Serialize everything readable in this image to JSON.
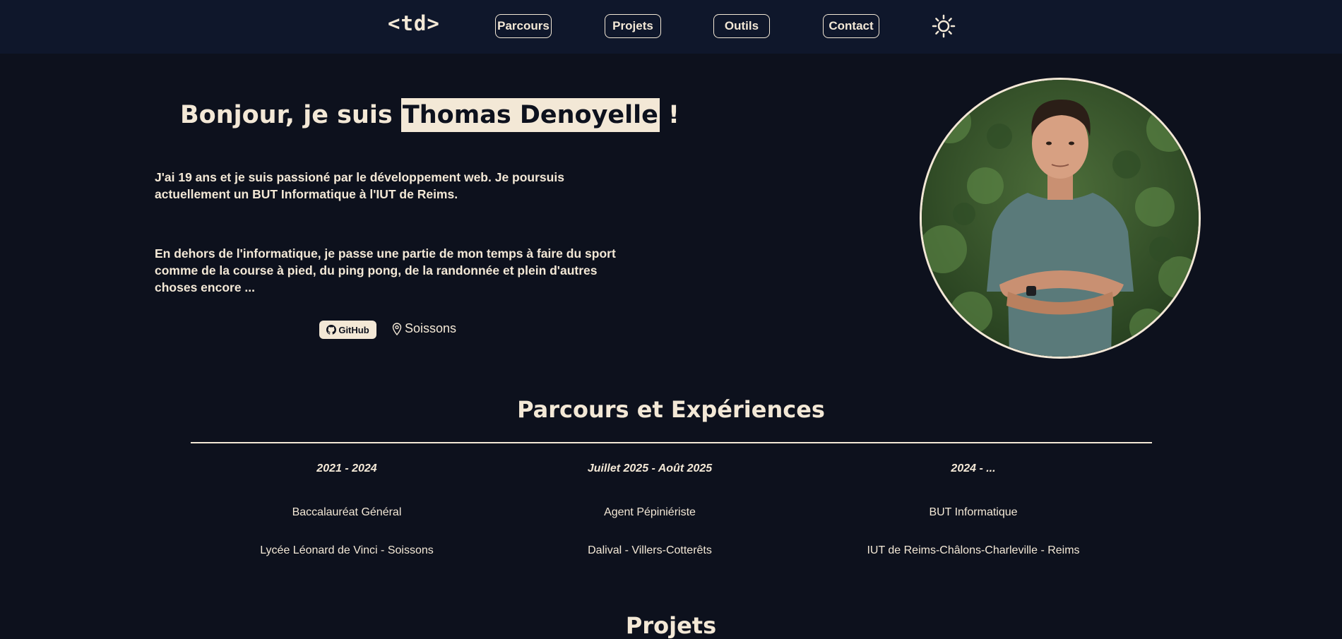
{
  "colors": {
    "background": "#0d111d",
    "nav_background": "#0f172b",
    "accent": "#f3e8d6"
  },
  "nav": {
    "logo": "<td>",
    "items": [
      {
        "label": "Parcours"
      },
      {
        "label": "Projets"
      },
      {
        "label": "Outils"
      },
      {
        "label": "Contact"
      }
    ],
    "theme_toggle_icon": "sun-icon"
  },
  "hero": {
    "greeting_prefix": "Bonjour, je suis ",
    "name": "Thomas Denoyelle",
    "greeting_suffix": " !",
    "paragraph_1": "J'ai 19 ans et je suis passioné par le développement web. Je poursuis actuellement un BUT Informatique à l'IUT de Reims.",
    "paragraph_2": "En dehors de l'informatique, je passe une partie de mon temps à faire du sport comme de la course à pied, du ping pong, de la randonnée et plein d'autres choses encore ...",
    "github_label": "GitHub",
    "github_icon": "github-icon",
    "location_icon": "map-pin-icon",
    "location": "Soissons"
  },
  "parcours": {
    "title": "Parcours et Expériences",
    "items": [
      {
        "period": "2021 - 2024",
        "role": "Baccalauréat Général",
        "place": "Lycée Léonard de Vinci - Soissons"
      },
      {
        "period": "Juillet 2025 - Août 2025",
        "role": "Agent Pépiniériste",
        "place": "Dalival - Villers-Cotterêts"
      },
      {
        "period": "2024 - ...",
        "role": "BUT Informatique",
        "place": "IUT de Reims-Châlons-Charleville - Reims"
      }
    ]
  },
  "projets": {
    "title": "Projets"
  }
}
